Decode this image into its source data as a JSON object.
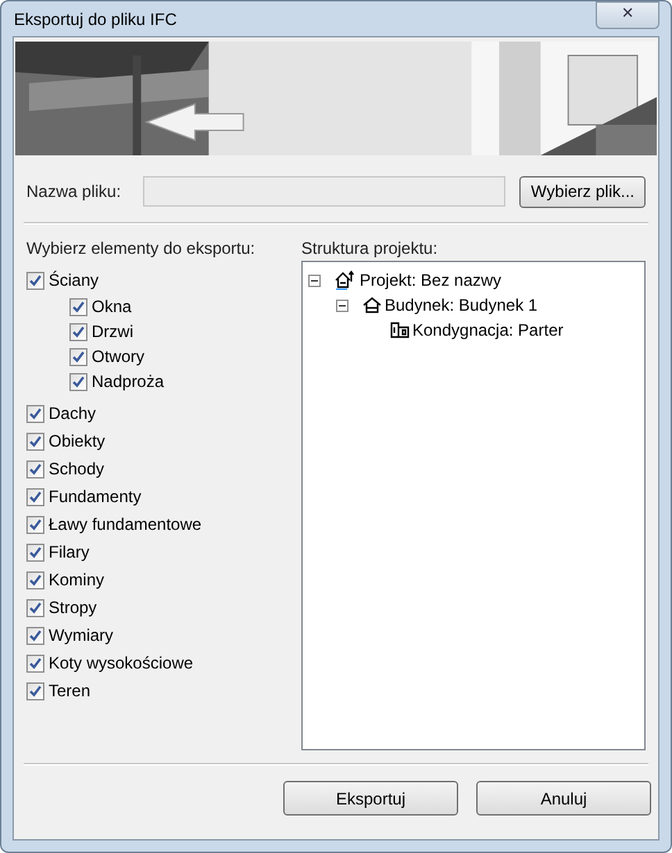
{
  "window": {
    "title": "Eksportuj do pliku IFC",
    "close": "✕"
  },
  "file": {
    "label": "Nazwa pliku:",
    "button": "Wybierz plik..."
  },
  "elements": {
    "label": "Wybierz elementy do eksportu:",
    "items": [
      {
        "label": "Ściany",
        "checked": true,
        "children": [
          {
            "label": "Okna",
            "checked": true
          },
          {
            "label": "Drzwi",
            "checked": true
          },
          {
            "label": "Otwory",
            "checked": true
          },
          {
            "label": "Nadproża",
            "checked": true
          }
        ]
      },
      {
        "label": "Dachy",
        "checked": true
      },
      {
        "label": "Obiekty",
        "checked": true
      },
      {
        "label": "Schody",
        "checked": true
      },
      {
        "label": "Fundamenty",
        "checked": true
      },
      {
        "label": "Ławy fundamentowe",
        "checked": true
      },
      {
        "label": "Filary",
        "checked": true
      },
      {
        "label": "Kominy",
        "checked": true
      },
      {
        "label": "Stropy",
        "checked": true
      },
      {
        "label": "Wymiary",
        "checked": true
      },
      {
        "label": "Koty wysokościowe",
        "checked": true
      },
      {
        "label": "Teren",
        "checked": true
      }
    ]
  },
  "structure": {
    "label": "Struktura projektu:",
    "tree": [
      {
        "label": "Projekt: Bez nazwy",
        "kind": "project",
        "expanded": true,
        "children": [
          {
            "label": "Budynek: Budynek 1",
            "kind": "building",
            "expanded": true,
            "children": [
              {
                "label": "Kondygnacja: Parter",
                "kind": "storey"
              }
            ]
          }
        ]
      }
    ]
  },
  "buttons": [
    "Eksportuj",
    "Anuluj"
  ]
}
